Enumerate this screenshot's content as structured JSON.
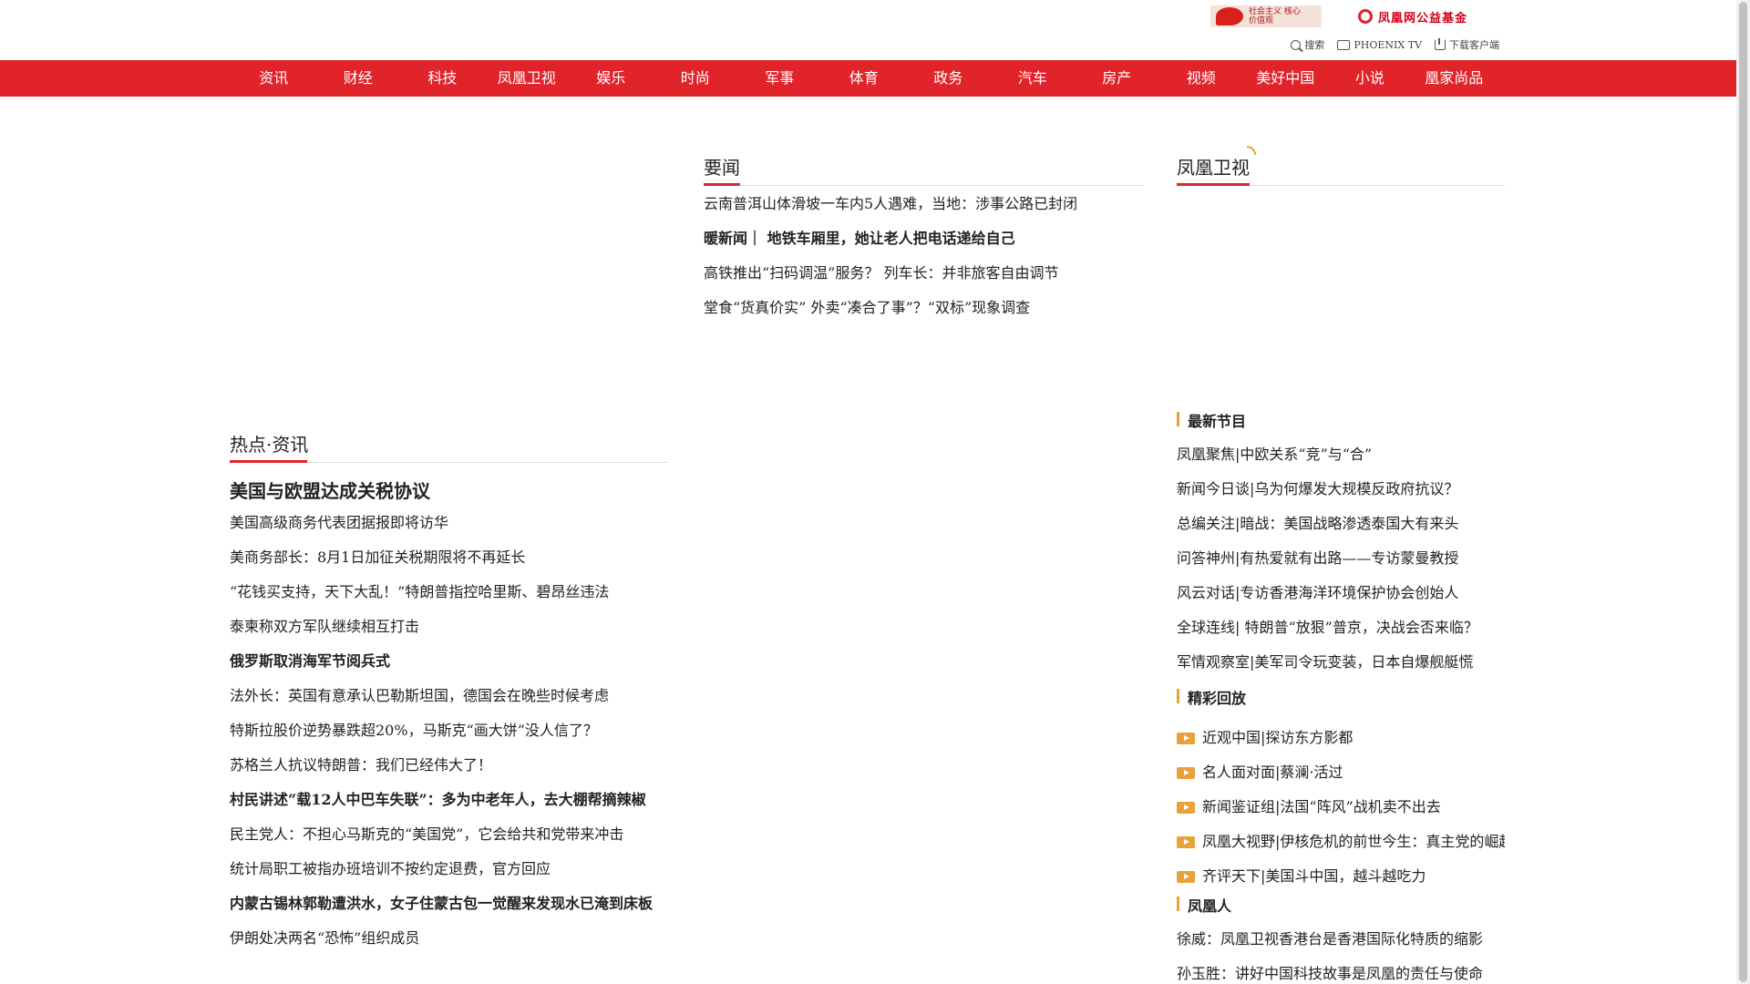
{
  "header": {
    "banner_left_text": "社会主义 核心价值观",
    "banner_right_text": "凤凰网公益基金",
    "tools": {
      "search": "搜索",
      "tv": "PHOENIX TV",
      "download": "下载客户端"
    }
  },
  "nav": {
    "items": [
      "资讯",
      "财经",
      "科技",
      "凤凰卫视",
      "娱乐",
      "时尚",
      "军事",
      "体育",
      "政务",
      "汽车",
      "房产",
      "视频",
      "美好中国",
      "小说",
      "凰家尚品"
    ]
  },
  "headlines": {
    "title": "要闻",
    "items": [
      {
        "text": "云南普洱山体滑坡一车内5人遇难，当地：涉事公路已封闭",
        "bold": false
      },
      {
        "text": "暖新闻｜  地铁车厢里，她让老人把电话递给自己",
        "bold": true
      },
      {
        "text": "高铁推出“扫码调温”服务？ 列车长：并非旅客自由调节",
        "bold": false
      },
      {
        "text": "堂食“货真价实” 外卖“凑合了事”？“双标”现象调查",
        "bold": false
      }
    ]
  },
  "hot": {
    "title": "热点·资讯",
    "lead": "美国与欧盟达成关税协议",
    "items": [
      {
        "text": "美国高级商务代表团据报即将访华",
        "bold": false
      },
      {
        "text": "美商务部长：8月1日加征关税期限将不再延长",
        "bold": false
      },
      {
        "text": "“花钱买支持，天下大乱！”特朗普指控哈里斯、碧昂丝违法",
        "bold": false
      },
      {
        "text": "泰柬称双方军队继续相互打击",
        "bold": false
      },
      {
        "text": "俄罗斯取消海军节阅兵式",
        "bold": true
      },
      {
        "text": "法外长：英国有意承认巴勒斯坦国，德国会在晚些时候考虑",
        "bold": false
      },
      {
        "text": "特斯拉股价逆势暴跌超20%，马斯克“画大饼”没人信了？",
        "bold": false
      },
      {
        "text": "苏格兰人抗议特朗普：我们已经伟大了！",
        "bold": false
      },
      {
        "text": "村民讲述“载12人中巴车失联”：多为中老年人，去大棚帮摘辣椒",
        "bold": true
      },
      {
        "text": "民主党人：不担心马斯克的“美国党”，它会给共和党带来冲击",
        "bold": false
      },
      {
        "text": "统计局职工被指办班培训不按约定退费，官方回应",
        "bold": false
      },
      {
        "text": "内蒙古锡林郭勒遭洪水，女子住蒙古包一觉醒来发现水已淹到床板",
        "bold": true
      },
      {
        "text": "伊朗处决两名“恐怖”组织成员",
        "bold": false
      }
    ]
  },
  "phoenix_tv": {
    "title": "凤凰卫视",
    "latest_title": "最新节目",
    "latest": [
      "凤凰聚焦|中欧关系“竞”与“合”",
      "新闻今日谈|乌为何爆发大规模反政府抗议？",
      "总编关注|暗战：美国战略渗透泰国大有来头",
      "问答神州|有热爱就有出路——专访蒙曼教授",
      "风云对话|专访香港海洋环境保护协会创始人",
      "全球连线| 特朗普“放狠”普京，决战会否来临？",
      "军情观察室|美军司令玩变装，日本自爆舰艇慌"
    ],
    "replay_title": "精彩回放",
    "replay": [
      "近观中国|探访东方影都",
      "名人面对面|蔡澜·活过",
      "新闻鉴证组|法国“阵风”战机卖不出去",
      "凤凰大视野|伊核危机的前世今生：真主党的崛起",
      "齐评天下|美国斗中国，越斗越吃力"
    ],
    "people_title": "凤凰人",
    "people": [
      "徐威：凤凰卫视香港台是香港国际化特质的缩影",
      "孙玉胜：讲好中国科技故事是凤凰的责任与使命"
    ]
  },
  "colors": {
    "brand_red": "#e1232a",
    "accent_orange": "#e8a23a"
  }
}
